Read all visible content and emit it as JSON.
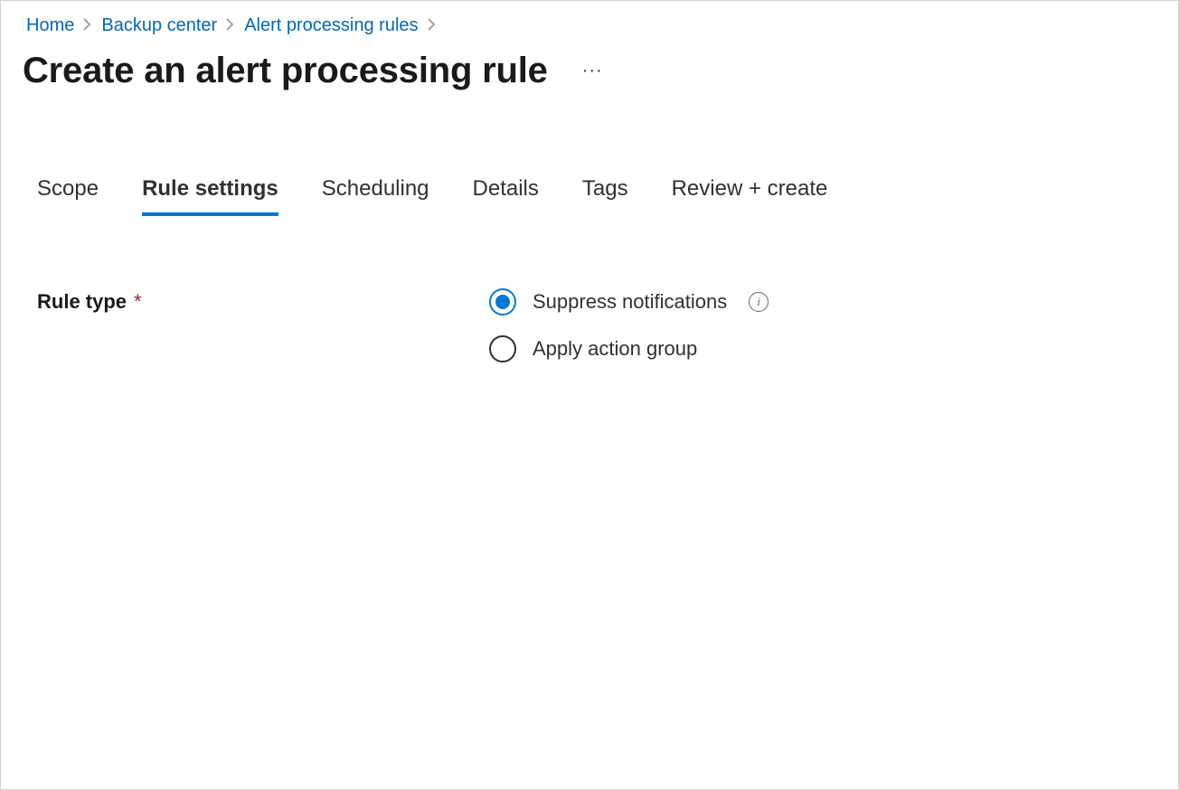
{
  "breadcrumb": {
    "items": [
      "Home",
      "Backup center",
      "Alert processing rules"
    ]
  },
  "header": {
    "title": "Create an alert processing rule",
    "more": "···"
  },
  "tabs": [
    {
      "label": "Scope",
      "active": false
    },
    {
      "label": "Rule settings",
      "active": true
    },
    {
      "label": "Scheduling",
      "active": false
    },
    {
      "label": "Details",
      "active": false
    },
    {
      "label": "Tags",
      "active": false
    },
    {
      "label": "Review + create",
      "active": false
    }
  ],
  "form": {
    "rule_type": {
      "label": "Rule type",
      "required_marker": "*",
      "options": [
        {
          "label": "Suppress notifications",
          "selected": true,
          "info": true
        },
        {
          "label": "Apply action group",
          "selected": false,
          "info": false
        }
      ]
    }
  },
  "icons": {
    "info_glyph": "i"
  }
}
